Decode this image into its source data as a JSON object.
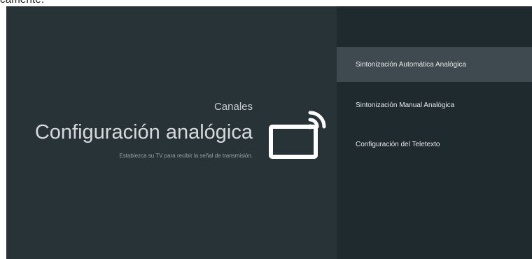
{
  "top_fragment": "camente.",
  "left": {
    "category": "Canales",
    "title": "Configuración analógica",
    "subtitle": "Establezca su TV para recibir la señal de transmisión."
  },
  "menu": {
    "items": [
      {
        "label": "Sintonización Automática Analógica",
        "selected": true
      },
      {
        "label": "Sintonización Manual Analógica",
        "selected": false
      },
      {
        "label": "Configuración del Teletexto",
        "selected": false
      }
    ]
  },
  "colors": {
    "background": "#283338",
    "panel": "#1f2a2f",
    "selected": "#3e4a50",
    "text": "#e8eaeb"
  },
  "icons": {
    "settings_icon": "tv-signal-icon"
  }
}
